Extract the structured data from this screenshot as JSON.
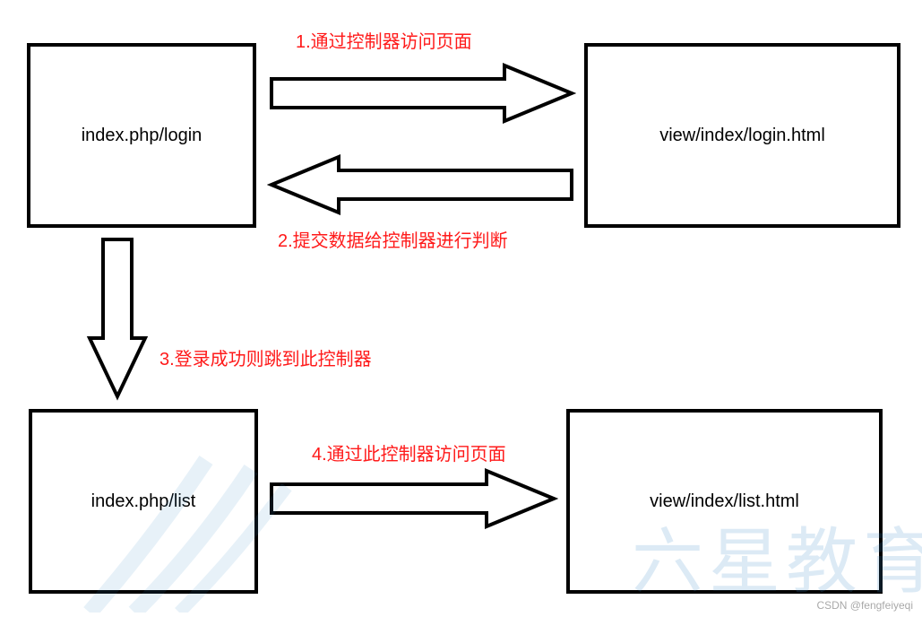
{
  "boxes": {
    "controller_login": "index.php/login",
    "view_login": "view/index/login.html",
    "controller_list": "index.php/list",
    "view_list": "view/index/list.html"
  },
  "labels": {
    "step1": "1.通过控制器访问页面",
    "step2": "2.提交数据给控制器进行判断",
    "step3": "3.登录成功则跳到此控制器",
    "step4": "4.通过此控制器访问页面"
  },
  "watermark": "六星教育",
  "credit": "CSDN @fengfeiyeqi"
}
